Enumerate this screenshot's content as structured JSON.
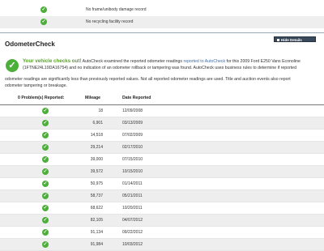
{
  "top_records": [
    {
      "text": "No frame/unibody damage record"
    },
    {
      "text": "No recycling facility record"
    }
  ],
  "odometer": {
    "title": "OdometerCheck",
    "hide_button": "Hide Details",
    "summary_lead": "Your vehicle checks out!",
    "summary_part1": " AutoCheck examined the reported odometer readings ",
    "summary_link": "reported to AutoCheck",
    "summary_part2": " for this 2009 Ford E250 Vans Econoline",
    "summary_line2": "(1FTNE24L19DA16754) and no indication of an odometer rollback or tampering was found. AutoCheck uses business rules to determine if reported",
    "summary_line3": "odometer readings are significantly less than previously reported values. Not all reported odometer readings are used. Title and auction events also report",
    "summary_line4": "odometer tampering or breakage."
  },
  "table": {
    "headers": {
      "problems": "0 Problem(s) Reported:",
      "mileage": "Mileage",
      "date": "Date Reported"
    },
    "rows": [
      {
        "mileage": "18",
        "date": "12/09/2008"
      },
      {
        "mileage": "6,901",
        "date": "03/13/2009"
      },
      {
        "mileage": "14,518",
        "date": "07/02/2009"
      },
      {
        "mileage": "29,214",
        "date": "02/17/2010"
      },
      {
        "mileage": "39,000",
        "date": "07/15/2010"
      },
      {
        "mileage": "39,572",
        "date": "10/15/2010"
      },
      {
        "mileage": "50,975",
        "date": "01/14/2011"
      },
      {
        "mileage": "58,737",
        "date": "05/21/2011"
      },
      {
        "mileage": "68,622",
        "date": "10/20/2011"
      },
      {
        "mileage": "82,105",
        "date": "04/07/2012"
      },
      {
        "mileage": "91,134",
        "date": "09/22/2012"
      },
      {
        "mileage": "91,984",
        "date": "10/03/2012"
      }
    ]
  },
  "colors": {
    "check_green": "#4caf3a",
    "header_dark": "#3a4a5c",
    "link_blue": "#3a6fb0"
  }
}
